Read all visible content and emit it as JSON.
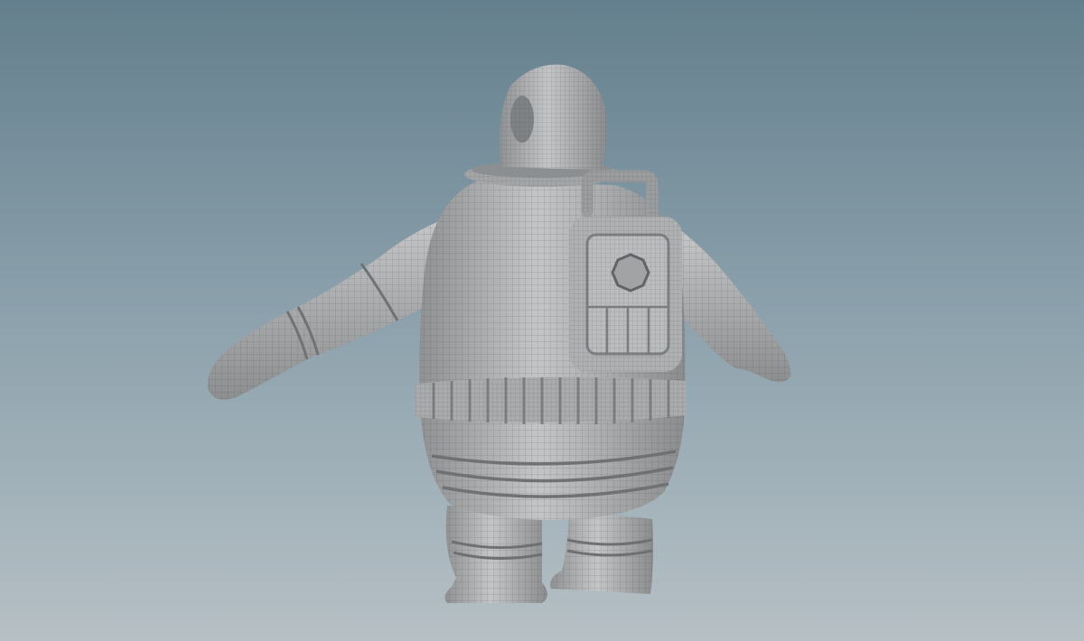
{
  "viewport": {
    "background_top": "#647f8d",
    "background_bottom": "#b6c0c5",
    "model_base_color": "#b2b3b4",
    "wire_color": "#555a5e",
    "subject": "astronaut-character-mesh"
  }
}
